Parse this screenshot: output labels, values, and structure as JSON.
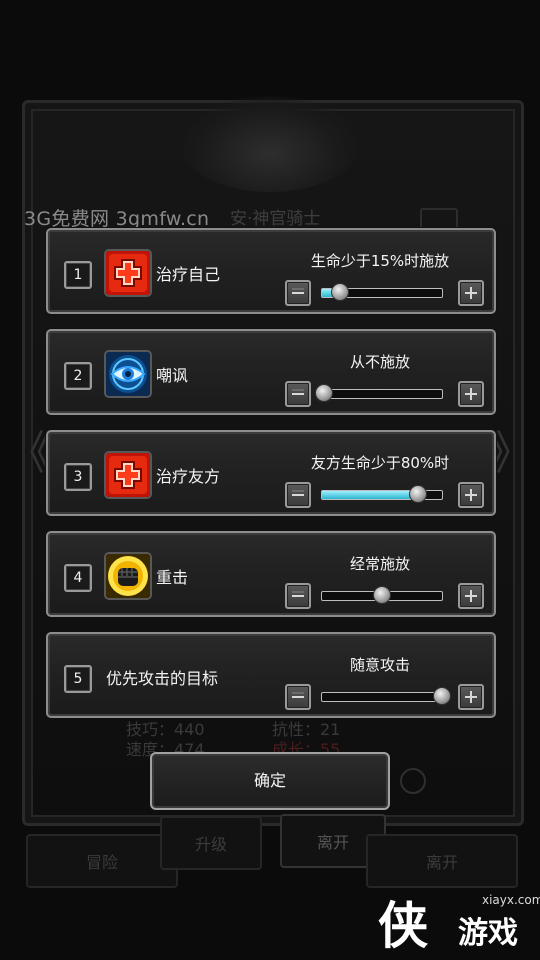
{
  "watermark": {
    "top_text": "3G免费网  3gmfw.cn",
    "site": "xiayx.com",
    "logo_glyph": "侠",
    "logo_text": "游戏"
  },
  "background": {
    "title": "安·神官骑士",
    "stat_rows": [
      "技巧：440",
      "抗性：21",
      "速度：474",
      "成长：55"
    ],
    "buttons": [
      "冒险",
      "升级",
      "离开",
      "离开"
    ]
  },
  "skills": [
    {
      "index": "1",
      "name": "治疗自己",
      "condition": "生命少于15%时施放",
      "icon": "heal-icon",
      "level": 0.15,
      "filled": true
    },
    {
      "index": "2",
      "name": "嘲讽",
      "condition": "从不施放",
      "icon": "taunt-eye-icon",
      "level": 0.0,
      "filled": false
    },
    {
      "index": "3",
      "name": "治疗友方",
      "condition": "友方生命少于80%时",
      "icon": "heal-icon",
      "level": 0.8,
      "filled": true
    },
    {
      "index": "4",
      "name": "重击",
      "condition": "经常施放",
      "icon": "fist-icon",
      "level": 0.5,
      "filled": false
    },
    {
      "index": "5",
      "name": "优先攻击的目标",
      "condition": "随意攻击",
      "icon": "",
      "level": 1.0,
      "filled": false
    }
  ],
  "confirm_label": "确定",
  "colors": {
    "slider_fill": "#2ab6cf",
    "heal_red": "#e01a0a",
    "eye_blue": "#1e8fe0",
    "fist_yellow": "#e8c21a"
  }
}
